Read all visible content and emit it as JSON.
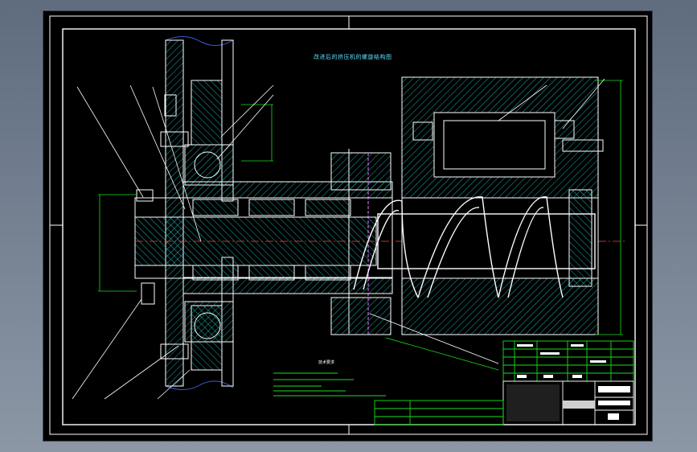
{
  "drawing": {
    "title": "改进后的挤压机的螺旋结构图",
    "notes_title": "技术要求",
    "colors": {
      "background": "#000000",
      "outline": "#ffffff",
      "hatch": "#2ad6d6",
      "dimension": "#18e018",
      "leader": "#ffffff",
      "title_text": "#5ee0ff",
      "table_line": "#18e018",
      "table_block": "#ffffff"
    }
  }
}
